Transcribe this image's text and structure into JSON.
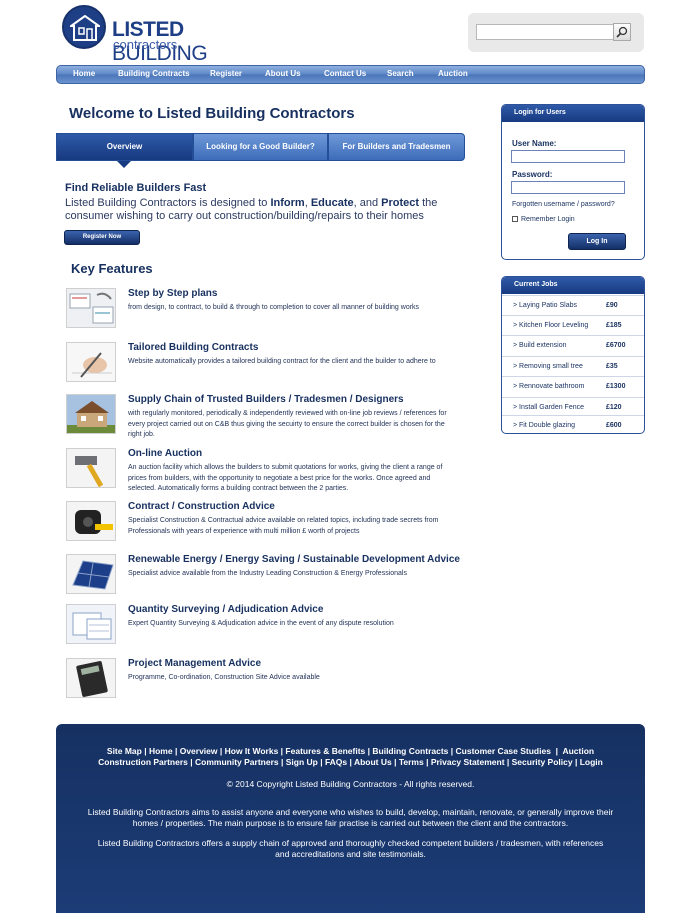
{
  "logo": {
    "word1": "LISTED",
    "word2": "BUILDING",
    "tagline": "contractors"
  },
  "search": {
    "placeholder": "",
    "value": ""
  },
  "nav": [
    "Home",
    "Building Contracts",
    "Register",
    "About Us",
    "Contact Us",
    "Search",
    "Auction"
  ],
  "welcome_title": "Welcome to Listed Building Contractors",
  "tabs": [
    "Overview",
    "Looking for a Good Builder?",
    "For Builders and Tradesmen"
  ],
  "intro": {
    "title": "Find Reliable Builders Fast",
    "text_1": "Listed Building Contractors is designed to ",
    "inform": "Inform",
    "sep_1": ", ",
    "educate": "Educate",
    "sep_2": ", and ",
    "protect": "Protect",
    "text_2": " the consumer wishing to carry out construction/building/repairs to their homes",
    "register_button": "Register Now"
  },
  "key_features_title": "Key Features",
  "features": [
    {
      "title": "Step by Step plans",
      "desc": "from design, to contract, to build & through to completion to cover all manner of building works",
      "icon": "plans-icon"
    },
    {
      "title": "Tailored Building Contracts",
      "desc": "Website automatically provides a tailored building contract for the client and the builder to adhere to",
      "icon": "contract-pen-icon"
    },
    {
      "title": "Supply Chain of Trusted Builders / Tradesmen / Designers",
      "desc": "with regularly monitored, periodically & independently reviewed with on-line job reviews / references for every project carried out on C&B thus giving the secuirty to ensure the correct builder is chosen for the right job.",
      "icon": "house-icon"
    },
    {
      "title": "On-line Auction",
      "desc": "An auction facility which allows the builders to submit quotations for works, giving the client a range of prices from builders, with the opportunity to negotiate a best price for the works. Once agreed and selected. Automatically forms a building contract between the 2 parties.",
      "icon": "hammer-icon"
    },
    {
      "title": "Contract / Construction Advice",
      "desc": "Specialist Construction & Contractual advice available on related topics, including trade secrets from Professionals with years of experience with multi million £ worth of projects",
      "icon": "tape-measure-icon"
    },
    {
      "title": "Renewable Energy / Energy Saving / Sustainable Development Advice",
      "desc": "Specialist advice available from the Industry Leading Construction & Energy Professionals",
      "icon": "solar-panel-icon"
    },
    {
      "title": "Quantity Surveying / Adjudication Advice",
      "desc": "Expert Quantity Surveying & Adjudication advice in the event of any dispute resolution",
      "icon": "blueprint-icon"
    },
    {
      "title": "Project Management Advice",
      "desc": "Programme, Co-ordination, Construction Site Advice available",
      "icon": "calculator-icon"
    }
  ],
  "login": {
    "title": "Login for Users",
    "username_label": "User Name:",
    "password_label": "Password:",
    "forgot": "Forgotten username / password?",
    "remember": "Remember Login",
    "button": "Log In"
  },
  "jobs": {
    "title": "Current Jobs",
    "items": [
      {
        "name": "> Laying Patio Slabs",
        "price": "£90"
      },
      {
        "name": "> Kitchen Floor Leveling",
        "price": "£185"
      },
      {
        "name": "> Build extension",
        "price": "£6700"
      },
      {
        "name": "> Removing small tree",
        "price": "£35"
      },
      {
        "name": "> Rennovate bathroom",
        "price": "£1300"
      },
      {
        "name": "> Install Garden Fence",
        "price": "£120"
      },
      {
        "name": "> Fit Double glazing",
        "price": "£600"
      }
    ]
  },
  "footer": {
    "links_row1": [
      "Site Map",
      "Home",
      "Overview",
      "How It Works",
      "Features & Benefits",
      "Building Contracts",
      "Customer Case Studies",
      "Auction"
    ],
    "links_row2": [
      "Construction Partners",
      "Community Partners",
      "Sign Up",
      "FAQs",
      "About Us",
      "Terms",
      "Privacy Statement",
      "Security Policy",
      "Login"
    ],
    "copyright": "© 2014 Copyright Listed Building Contractors - All rights reserved.",
    "about": "Listed Building Contractors aims to assist anyone and everyone who wishes to build, develop, maintain, renovate, or generally improve their homes / properties. The main purpose is to ensure fair practise is carried out between the client and the contractors.",
    "supply": "Listed Building Contractors offers a supply chain of approved and thoroughly checked competent builders / tradesmen, with references and accreditations and site testimonials."
  }
}
